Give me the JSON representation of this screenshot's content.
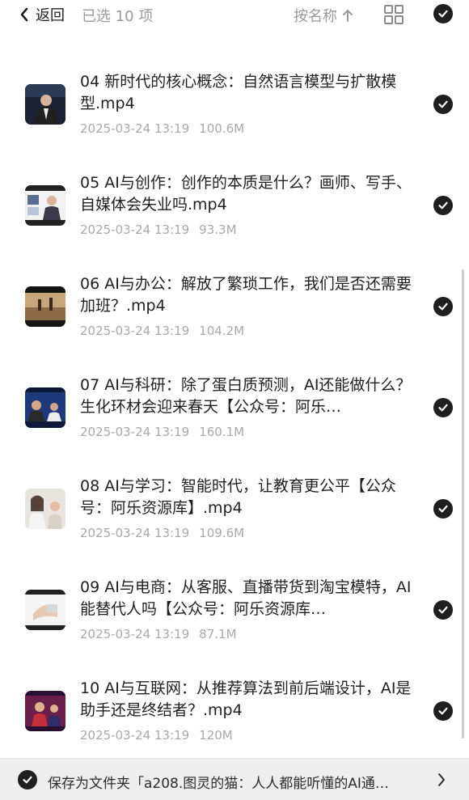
{
  "header": {
    "back_label": "返回",
    "selected_label": "已选 10 项",
    "sort_label": "按名称"
  },
  "icons": {
    "back": "chevron-left-icon",
    "sort_direction": "arrow-up-icon",
    "view_mode": "grid-icon",
    "select": "check-circle-icon"
  },
  "colors": {
    "text_primary": "#1f1f1f",
    "text_secondary": "#a8a8a8",
    "check_fill": "#1f1f1f",
    "bottom_bar": "#eeeeee"
  },
  "files": [
    {
      "title": "04 新时代的核心概念：自然语言模型与扩散模型.mp4",
      "date": "2025-03-24 13:19",
      "size": "100.6M"
    },
    {
      "title": "05 AI与创作：创作的本质是什么？画师、写手、自媒体会失业吗.mp4",
      "date": "2025-03-24 13:19",
      "size": "93.3M"
    },
    {
      "title": "06 AI与办公：解放了繁琐工作，我们是否还需要加班？.mp4",
      "date": "2025-03-24 13:19",
      "size": "104.2M"
    },
    {
      "title": "07 AI与科研：除了蛋白质预测，AI还能做什么？生化环材会迎来春天【公众号：阿乐…",
      "date": "2025-03-24 13:19",
      "size": "160.1M"
    },
    {
      "title": "08 AI与学习：智能时代，让教育更公平【公众号：阿乐资源库】.mp4",
      "date": "2025-03-24 13:19",
      "size": "109.6M"
    },
    {
      "title": "09 AI与电商：从客服、直播带货到淘宝模特，AI能替代人吗【公众号：阿乐资源库…",
      "date": "2025-03-24 13:19",
      "size": "87.1M"
    },
    {
      "title": "10 AI与互联网：从推荐算法到前后端设计，AI是助手还是终结者？.mp4",
      "date": "2025-03-24 13:19",
      "size": "120M"
    }
  ],
  "footer": {
    "save_text": "保存为文件夹「a208.图灵的猫：人人都能听懂的AI通…"
  }
}
